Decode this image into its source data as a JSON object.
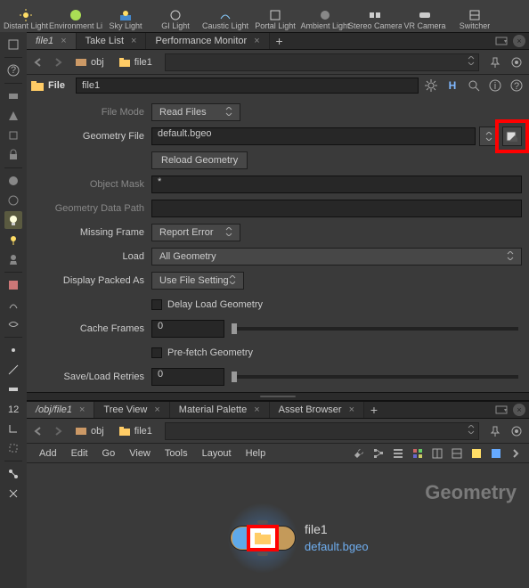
{
  "shelf": [
    {
      "label": "Distant Light",
      "icon": "sun"
    },
    {
      "label": "Environment Light",
      "icon": "env"
    },
    {
      "label": "Sky Light",
      "icon": "sky"
    },
    {
      "label": "GI Light",
      "icon": "gi"
    },
    {
      "label": "Caustic Light",
      "icon": "caustic"
    },
    {
      "label": "Portal Light",
      "icon": "portal"
    },
    {
      "label": "Ambient Light",
      "icon": "ambient"
    },
    {
      "label": "Stereo Camera",
      "icon": "stereo"
    },
    {
      "label": "VR Camera",
      "icon": "vr"
    },
    {
      "label": "Switcher",
      "icon": "switch"
    }
  ],
  "tabs_upper": [
    {
      "label": "file1",
      "closeable": true,
      "active": true
    },
    {
      "label": "Take List",
      "closeable": true,
      "active": false
    },
    {
      "label": "Performance Monitor",
      "closeable": true,
      "active": false
    }
  ],
  "path_upper": [
    {
      "label": "obj",
      "icon": "scene"
    },
    {
      "label": "file1",
      "icon": "folder"
    }
  ],
  "op_header": {
    "type": "File",
    "name": "file1"
  },
  "params": {
    "file_mode": {
      "label": "File Mode",
      "value": "Read Files"
    },
    "geometry_file": {
      "label": "Geometry File",
      "value": "default.bgeo"
    },
    "reload": {
      "label": "Reload Geometry"
    },
    "object_mask": {
      "label": "Object Mask",
      "value": "*"
    },
    "geo_data_path": {
      "label": "Geometry Data Path",
      "value": ""
    },
    "missing_frame": {
      "label": "Missing Frame",
      "value": "Report Error"
    },
    "load": {
      "label": "Load",
      "value": "All Geometry"
    },
    "display_packed": {
      "label": "Display Packed As",
      "value": "Use File Setting"
    },
    "delay_load": {
      "label": "Delay Load Geometry"
    },
    "cache_frames": {
      "label": "Cache Frames",
      "value": "0"
    },
    "prefetch": {
      "label": "Pre-fetch Geometry"
    },
    "retries": {
      "label": "Save/Load Retries",
      "value": "0"
    }
  },
  "tabs_lower": [
    {
      "label": "/obj/file1",
      "closeable": true,
      "active": true
    },
    {
      "label": "Tree View",
      "closeable": true,
      "active": false
    },
    {
      "label": "Material Palette",
      "closeable": true,
      "active": false
    },
    {
      "label": "Asset Browser",
      "closeable": true,
      "active": false
    }
  ],
  "path_lower": [
    {
      "label": "obj",
      "icon": "scene"
    },
    {
      "label": "file1",
      "icon": "folder"
    }
  ],
  "menus": [
    "Add",
    "Edit",
    "Go",
    "View",
    "Tools",
    "Layout",
    "Help"
  ],
  "network": {
    "watermark": "Geometry",
    "node_name": "file1",
    "node_file": "default.bgeo"
  }
}
